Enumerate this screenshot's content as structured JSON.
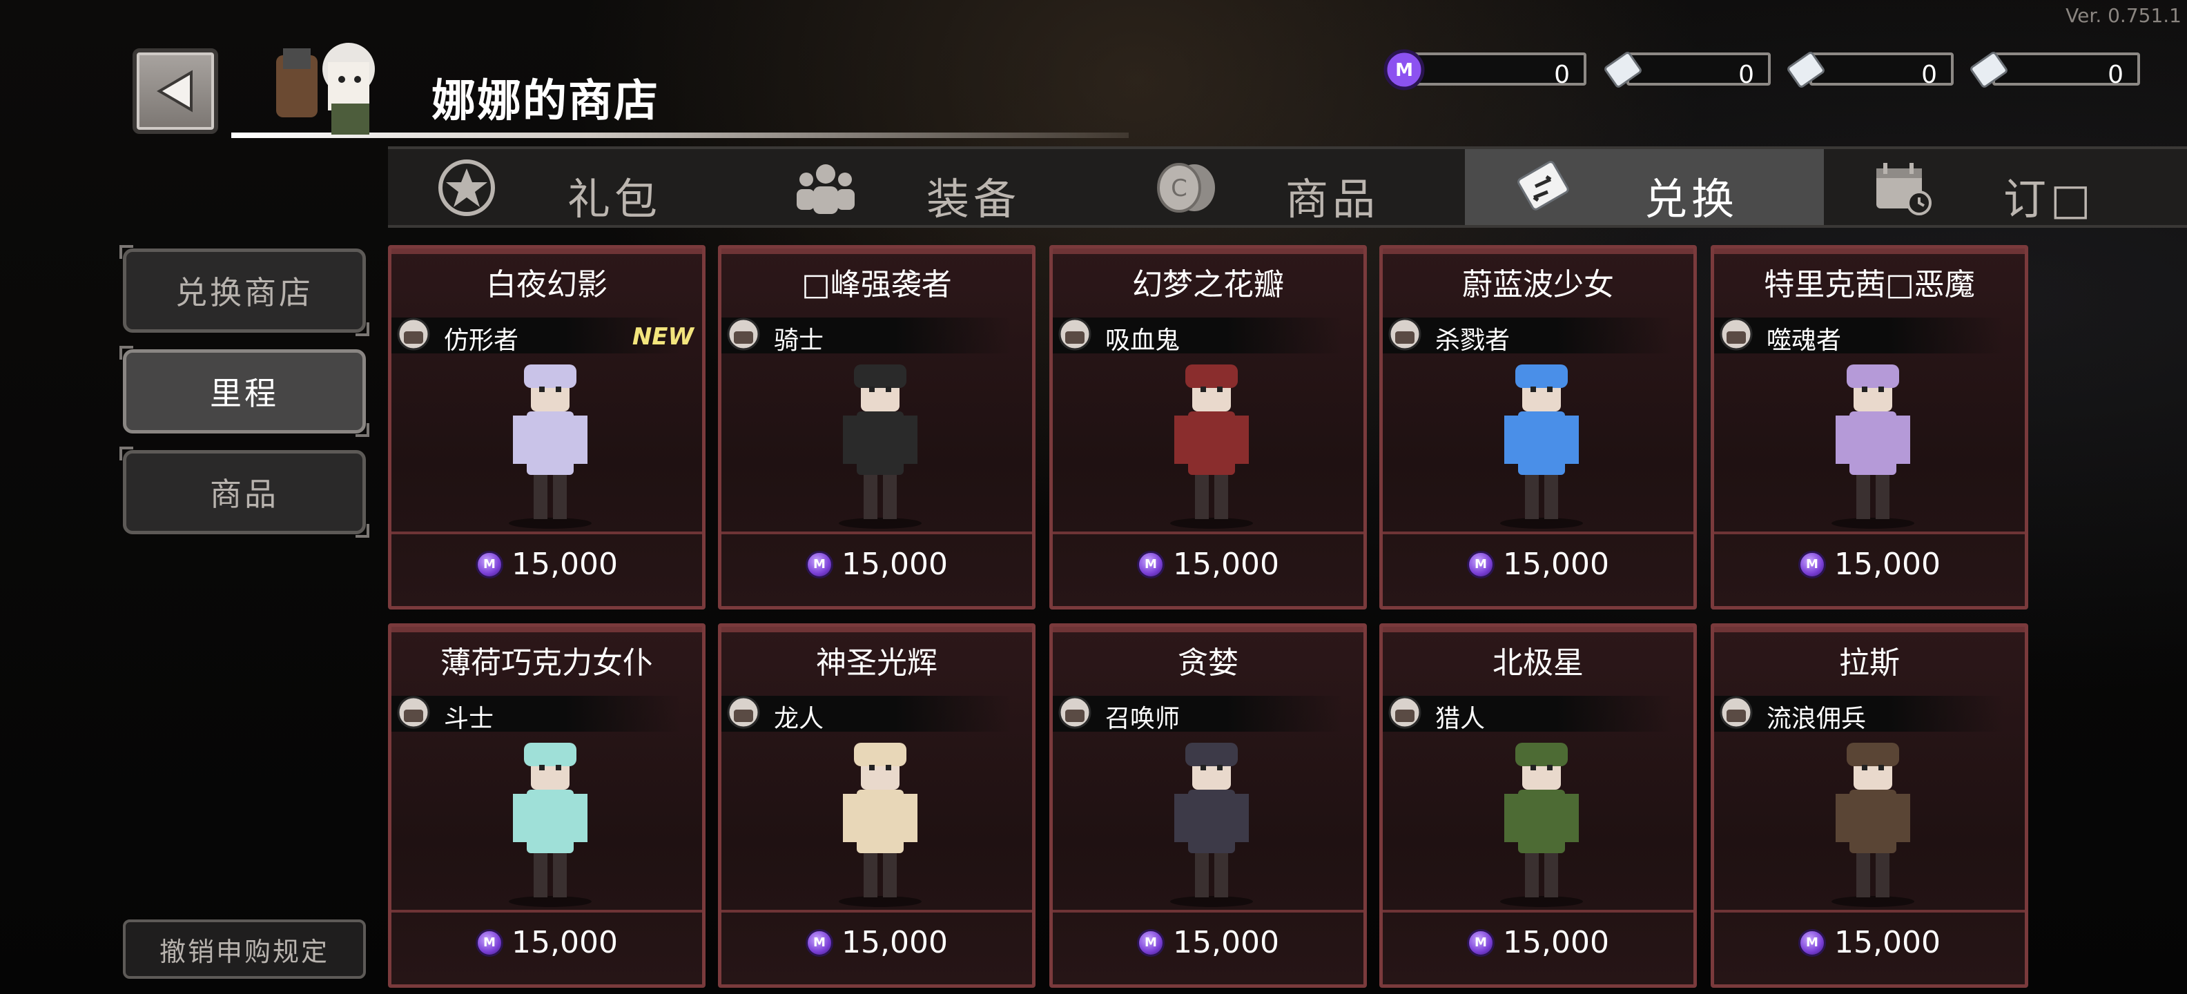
{
  "app": {
    "version": "Ver. 0.751.1",
    "title": "娜娜的商店"
  },
  "currencies": [
    {
      "icon": "m-coin-icon",
      "value": "0",
      "color": "#8c52f0"
    },
    {
      "icon": "ticket-icon",
      "value": "0"
    },
    {
      "icon": "ticket-2-icon",
      "value": "0"
    },
    {
      "icon": "ticket-3-icon",
      "value": "0"
    }
  ],
  "tabs": [
    {
      "label": "礼包",
      "icon": "star-icon"
    },
    {
      "label": "装备",
      "icon": "people-icon"
    },
    {
      "label": "商品",
      "icon": "coins-icon"
    },
    {
      "label": "兑换",
      "icon": "exchange-ticket-icon",
      "active": true
    },
    {
      "label": "订□",
      "icon": "calendar-icon"
    }
  ],
  "sidebar": {
    "items": [
      {
        "label": "兑换商店"
      },
      {
        "label": "里程",
        "active": true
      },
      {
        "label": "商品"
      }
    ],
    "policy": "撤销申购规定"
  },
  "items": [
    {
      "name": "白夜幻影",
      "class": "仿形者",
      "price": "15,000",
      "new": "NEW",
      "color": "#c9c3e8"
    },
    {
      "name": "□峰强袭者",
      "class": "骑士",
      "price": "15,000",
      "color": "#2a2a2a"
    },
    {
      "name": "幻梦之花瓣",
      "class": "吸血鬼",
      "price": "15,000",
      "color": "#8a2d2d"
    },
    {
      "name": "蔚蓝波少女",
      "class": "杀戮者",
      "price": "15,000",
      "color": "#4a8fe8"
    },
    {
      "name": "特里克茜□恶魔",
      "class": "噬魂者",
      "price": "15,000",
      "color": "#b59ad8"
    },
    {
      "name": "薄荷巧克力女仆",
      "class": "斗士",
      "price": "15,000",
      "color": "#9fe0d8"
    },
    {
      "name": "神圣光辉",
      "class": "龙人",
      "price": "15,000",
      "color": "#e8d7b8"
    },
    {
      "name": "贪婪",
      "class": "召唤师",
      "price": "15,000",
      "color": "#3d3a48"
    },
    {
      "name": "北极星",
      "class": "猎人",
      "price": "15,000",
      "color": "#4d6b34"
    },
    {
      "name": "拉斯",
      "class": "流浪佣兵",
      "price": "15,000",
      "color": "#5a4535"
    }
  ]
}
